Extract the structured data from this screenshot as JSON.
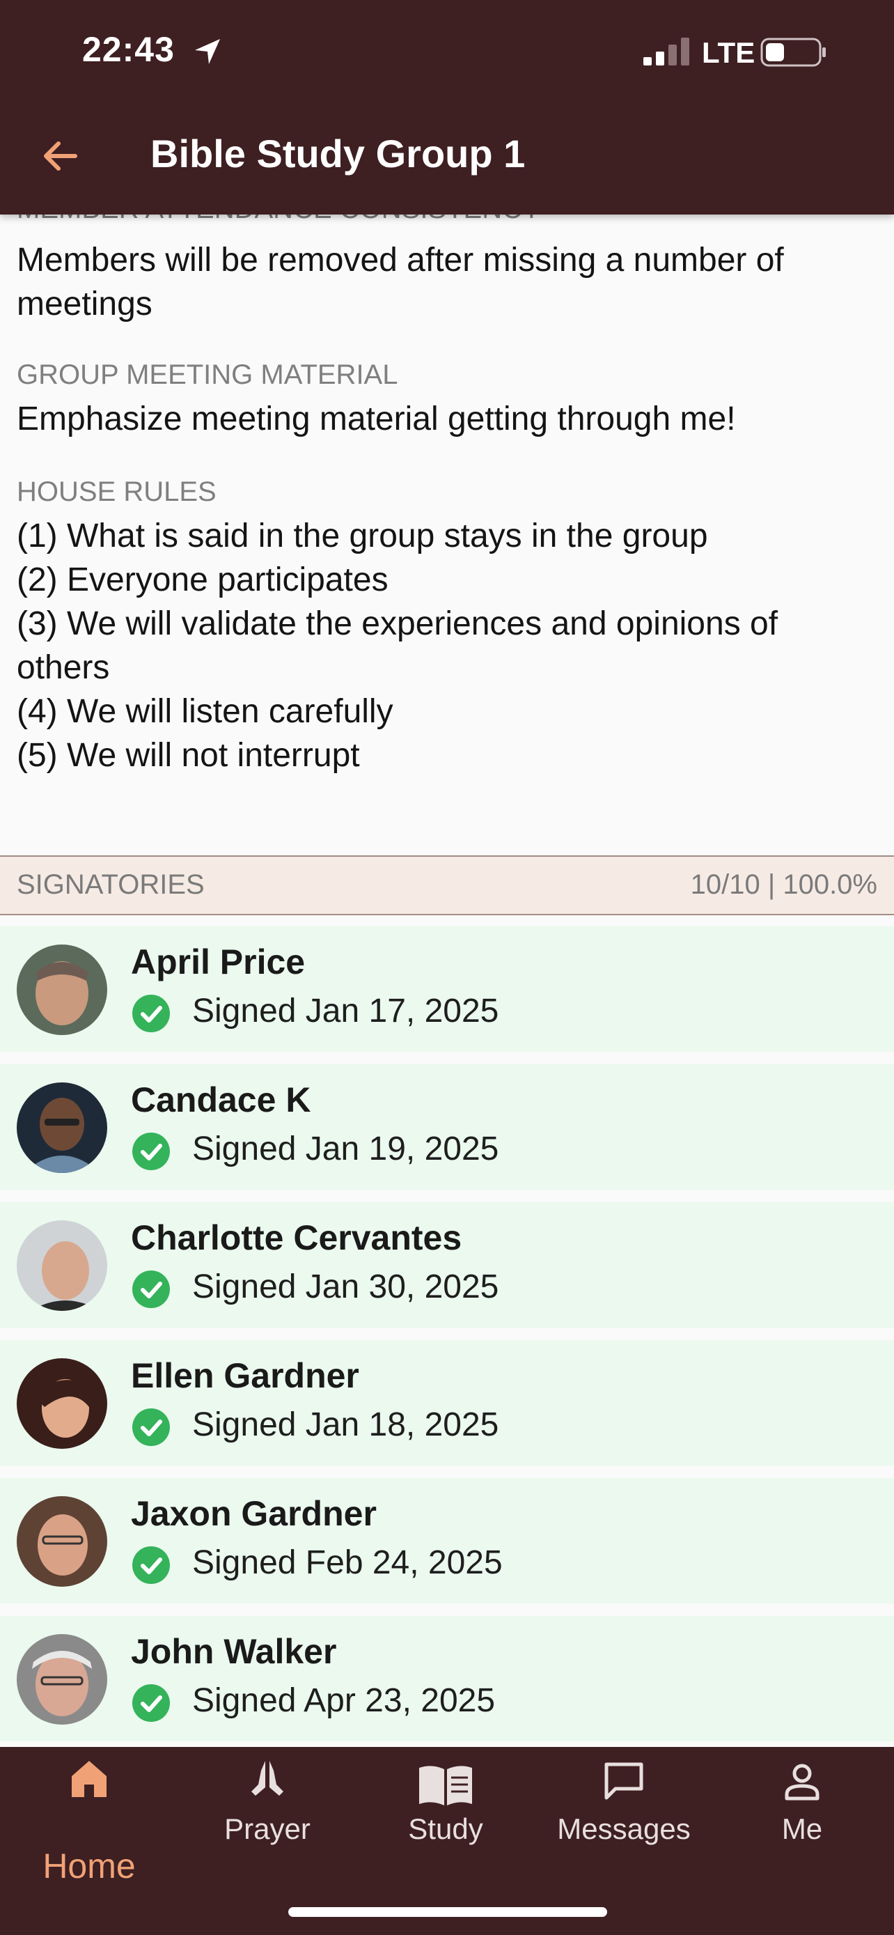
{
  "status_bar": {
    "time": "22:43",
    "network": "LTE"
  },
  "header": {
    "title": "Bible Study Group 1"
  },
  "sections": {
    "attendance": {
      "label": "MEMBER ATTENDANCE CONSISTENCY",
      "text": "Members will be removed after missing a number of meetings"
    },
    "material": {
      "label": "GROUP MEETING MATERIAL",
      "text": "Emphasize meeting material getting through me!"
    },
    "rules": {
      "label": "HOUSE RULES",
      "lines": [
        "(1) What is said in the group stays in the group",
        "(2) Everyone participates",
        "(3) We will validate the experiences and opinions of",
        "others",
        "(4) We will listen carefully",
        "(5) We will not interrupt"
      ]
    }
  },
  "signatories": {
    "label": "SIGNATORIES",
    "count": "10/10 | 100.0%",
    "items": [
      {
        "name": "April Price",
        "signed": "Signed Jan 17, 2025"
      },
      {
        "name": "Candace K",
        "signed": "Signed Jan 19, 2025"
      },
      {
        "name": "Charlotte Cervantes",
        "signed": "Signed Jan 30, 2025"
      },
      {
        "name": "Ellen Gardner",
        "signed": "Signed Jan 18, 2025"
      },
      {
        "name": "Jaxon Gardner",
        "signed": "Signed Feb 24, 2025"
      },
      {
        "name": "John Walker",
        "signed": "Signed Apr 23, 2025"
      }
    ]
  },
  "tabs": [
    {
      "label": "Home",
      "icon": "home-icon",
      "active": true
    },
    {
      "label": "Prayer",
      "icon": "praying-hands-icon"
    },
    {
      "label": "Study",
      "icon": "book-icon"
    },
    {
      "label": "Messages",
      "icon": "chat-bubble-icon"
    },
    {
      "label": "Me",
      "icon": "person-icon"
    }
  ],
  "colors": {
    "header_bg": "#3e1f22",
    "accent": "#f0a276",
    "signer_bg": "#ebf9ef",
    "check_green": "#34b35a"
  }
}
